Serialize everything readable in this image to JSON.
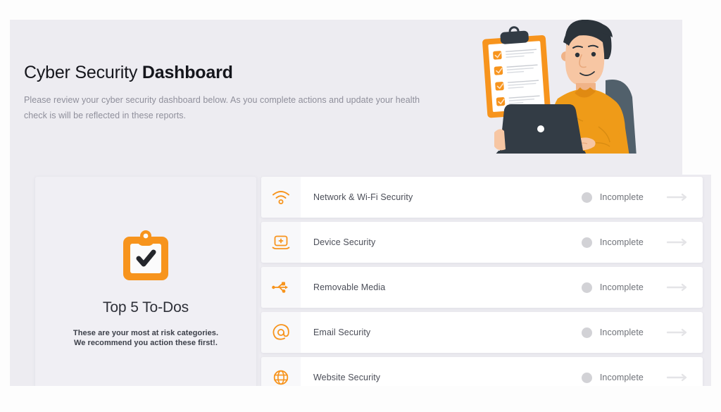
{
  "header": {
    "title_regular": "Cyber Security ",
    "title_bold": "Dashboard",
    "subtitle": "Please review your cyber security dashboard below. As you complete actions and update your health check is will be reflected in these reports."
  },
  "illustration": {
    "name": "person-at-laptop-with-clipboard-illustration",
    "clipboard_checkbox_count": 4,
    "colors": {
      "orange": "#F7941D",
      "dark": "#333C45",
      "skin": "#F7C6A3",
      "chair": "#51606B"
    }
  },
  "todo_card": {
    "icon": "clipboard-check-icon",
    "heading": "Top 5 To-Dos",
    "description_line1": "These are your most at risk categories.",
    "description_line2": "We recommend you action these first!."
  },
  "checklist": {
    "status_label": "Incomplete",
    "rows": [
      {
        "icon": "wifi-icon",
        "label": "Network & Wi-Fi Security",
        "status": "Incomplete"
      },
      {
        "icon": "laptop-plus-icon",
        "label": "Device Security",
        "status": "Incomplete"
      },
      {
        "icon": "usb-icon",
        "label": "Removable Media",
        "status": "Incomplete"
      },
      {
        "icon": "at-sign-icon",
        "label": "Email Security",
        "status": "Incomplete"
      },
      {
        "icon": "globe-icon",
        "label": "Website Security",
        "status": "Incomplete"
      }
    ]
  },
  "theme": {
    "accent_orange": "#F7941D",
    "panel_background": "#EDECF1",
    "page_background": "#FDFDFD",
    "card_background": "#F0EFF4",
    "row_background": "#FFFFFF",
    "status_dot_gray": "#D2D2D6",
    "title_color": "#15161C",
    "subtitle_color": "#8F8F9B"
  }
}
